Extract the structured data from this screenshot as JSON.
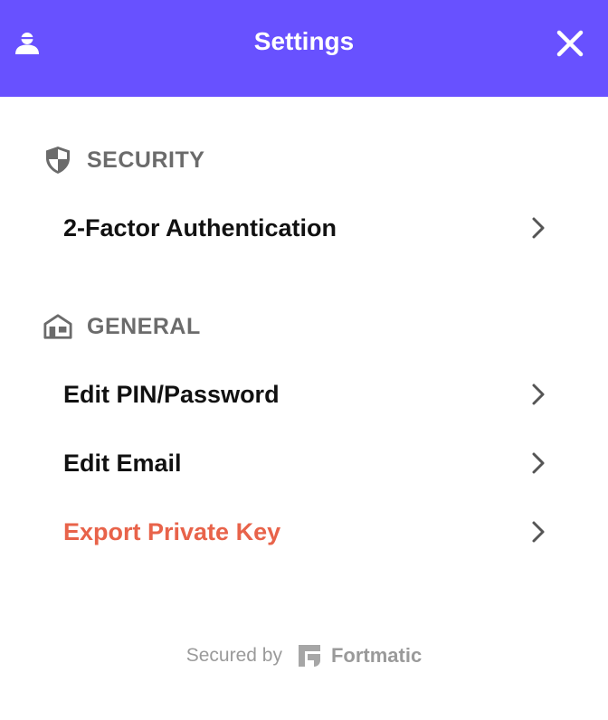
{
  "header": {
    "title": "Settings",
    "accent_color": "#6851ff",
    "left_icon": "user-icon",
    "right_icon": "close-icon"
  },
  "security": {
    "heading": "SECURITY",
    "icon": "shield-icon",
    "items": [
      {
        "label": "2-Factor Authentication",
        "icon": "chevron-right-icon"
      }
    ]
  },
  "general": {
    "heading": "GENERAL",
    "icon": "house-icon",
    "items": [
      {
        "label": "Edit PIN/Password",
        "icon": "chevron-right-icon"
      },
      {
        "label": "Edit Email",
        "icon": "chevron-right-icon"
      },
      {
        "label": "Export Private Key",
        "icon": "chevron-right-icon",
        "color": "#e8634a"
      }
    ]
  },
  "footer": {
    "secured_text": "Secured by",
    "brand": "Fortmatic",
    "brand_icon": "fortmatic-logo-icon"
  }
}
